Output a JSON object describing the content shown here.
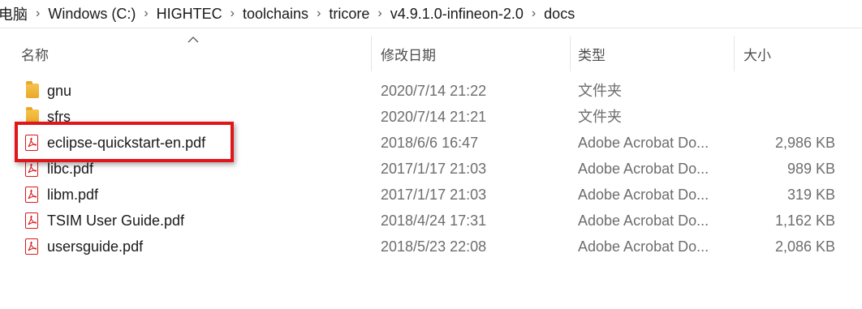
{
  "breadcrumb": {
    "items": [
      "电脑",
      "Windows (C:)",
      "HIGHTEC",
      "toolchains",
      "tricore",
      "v4.9.1.0-infineon-2.0",
      "docs"
    ],
    "separator": "›"
  },
  "columns": {
    "name": "名称",
    "date": "修改日期",
    "type": "类型",
    "size": "大小"
  },
  "files": [
    {
      "name": "gnu",
      "date": "2020/7/14 21:22",
      "type": "文件夹",
      "size": "",
      "icon": "folder-icon"
    },
    {
      "name": "sfrs",
      "date": "2020/7/14 21:21",
      "type": "文件夹",
      "size": "",
      "icon": "folder-icon"
    },
    {
      "name": "eclipse-quickstart-en.pdf",
      "date": "2018/6/6 16:47",
      "type": "Adobe Acrobat Do...",
      "size": "2,986 KB",
      "icon": "pdf-icon"
    },
    {
      "name": "libc.pdf",
      "date": "2017/1/17 21:03",
      "type": "Adobe Acrobat Do...",
      "size": "989 KB",
      "icon": "pdf-icon"
    },
    {
      "name": "libm.pdf",
      "date": "2017/1/17 21:03",
      "type": "Adobe Acrobat Do...",
      "size": "319 KB",
      "icon": "pdf-icon"
    },
    {
      "name": "TSIM User Guide.pdf",
      "date": "2018/4/24 17:31",
      "type": "Adobe Acrobat Do...",
      "size": "1,162 KB",
      "icon": "pdf-icon"
    },
    {
      "name": "usersguide.pdf",
      "date": "2018/5/23 22:08",
      "type": "Adobe Acrobat Do...",
      "size": "2,086 KB",
      "icon": "pdf-icon"
    }
  ],
  "colors": {
    "highlight": "#e0161a",
    "pdf_red": "#d8191b",
    "folder": "#f6c44e"
  }
}
